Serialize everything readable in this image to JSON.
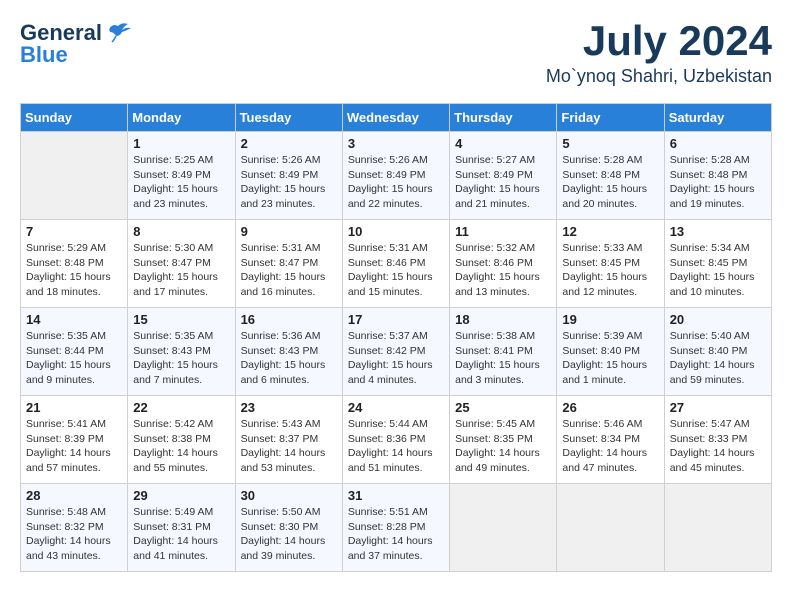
{
  "header": {
    "logo_general": "General",
    "logo_blue": "Blue",
    "month": "July 2024",
    "location": "Mo`ynoq Shahri, Uzbekistan"
  },
  "calendar": {
    "days_of_week": [
      "Sunday",
      "Monday",
      "Tuesday",
      "Wednesday",
      "Thursday",
      "Friday",
      "Saturday"
    ],
    "weeks": [
      [
        {
          "day": "",
          "info": ""
        },
        {
          "day": "1",
          "info": "Sunrise: 5:25 AM\nSunset: 8:49 PM\nDaylight: 15 hours\nand 23 minutes."
        },
        {
          "day": "2",
          "info": "Sunrise: 5:26 AM\nSunset: 8:49 PM\nDaylight: 15 hours\nand 23 minutes."
        },
        {
          "day": "3",
          "info": "Sunrise: 5:26 AM\nSunset: 8:49 PM\nDaylight: 15 hours\nand 22 minutes."
        },
        {
          "day": "4",
          "info": "Sunrise: 5:27 AM\nSunset: 8:49 PM\nDaylight: 15 hours\nand 21 minutes."
        },
        {
          "day": "5",
          "info": "Sunrise: 5:28 AM\nSunset: 8:48 PM\nDaylight: 15 hours\nand 20 minutes."
        },
        {
          "day": "6",
          "info": "Sunrise: 5:28 AM\nSunset: 8:48 PM\nDaylight: 15 hours\nand 19 minutes."
        }
      ],
      [
        {
          "day": "7",
          "info": "Sunrise: 5:29 AM\nSunset: 8:48 PM\nDaylight: 15 hours\nand 18 minutes."
        },
        {
          "day": "8",
          "info": "Sunrise: 5:30 AM\nSunset: 8:47 PM\nDaylight: 15 hours\nand 17 minutes."
        },
        {
          "day": "9",
          "info": "Sunrise: 5:31 AM\nSunset: 8:47 PM\nDaylight: 15 hours\nand 16 minutes."
        },
        {
          "day": "10",
          "info": "Sunrise: 5:31 AM\nSunset: 8:46 PM\nDaylight: 15 hours\nand 15 minutes."
        },
        {
          "day": "11",
          "info": "Sunrise: 5:32 AM\nSunset: 8:46 PM\nDaylight: 15 hours\nand 13 minutes."
        },
        {
          "day": "12",
          "info": "Sunrise: 5:33 AM\nSunset: 8:45 PM\nDaylight: 15 hours\nand 12 minutes."
        },
        {
          "day": "13",
          "info": "Sunrise: 5:34 AM\nSunset: 8:45 PM\nDaylight: 15 hours\nand 10 minutes."
        }
      ],
      [
        {
          "day": "14",
          "info": "Sunrise: 5:35 AM\nSunset: 8:44 PM\nDaylight: 15 hours\nand 9 minutes."
        },
        {
          "day": "15",
          "info": "Sunrise: 5:35 AM\nSunset: 8:43 PM\nDaylight: 15 hours\nand 7 minutes."
        },
        {
          "day": "16",
          "info": "Sunrise: 5:36 AM\nSunset: 8:43 PM\nDaylight: 15 hours\nand 6 minutes."
        },
        {
          "day": "17",
          "info": "Sunrise: 5:37 AM\nSunset: 8:42 PM\nDaylight: 15 hours\nand 4 minutes."
        },
        {
          "day": "18",
          "info": "Sunrise: 5:38 AM\nSunset: 8:41 PM\nDaylight: 15 hours\nand 3 minutes."
        },
        {
          "day": "19",
          "info": "Sunrise: 5:39 AM\nSunset: 8:40 PM\nDaylight: 15 hours\nand 1 minute."
        },
        {
          "day": "20",
          "info": "Sunrise: 5:40 AM\nSunset: 8:40 PM\nDaylight: 14 hours\nand 59 minutes."
        }
      ],
      [
        {
          "day": "21",
          "info": "Sunrise: 5:41 AM\nSunset: 8:39 PM\nDaylight: 14 hours\nand 57 minutes."
        },
        {
          "day": "22",
          "info": "Sunrise: 5:42 AM\nSunset: 8:38 PM\nDaylight: 14 hours\nand 55 minutes."
        },
        {
          "day": "23",
          "info": "Sunrise: 5:43 AM\nSunset: 8:37 PM\nDaylight: 14 hours\nand 53 minutes."
        },
        {
          "day": "24",
          "info": "Sunrise: 5:44 AM\nSunset: 8:36 PM\nDaylight: 14 hours\nand 51 minutes."
        },
        {
          "day": "25",
          "info": "Sunrise: 5:45 AM\nSunset: 8:35 PM\nDaylight: 14 hours\nand 49 minutes."
        },
        {
          "day": "26",
          "info": "Sunrise: 5:46 AM\nSunset: 8:34 PM\nDaylight: 14 hours\nand 47 minutes."
        },
        {
          "day": "27",
          "info": "Sunrise: 5:47 AM\nSunset: 8:33 PM\nDaylight: 14 hours\nand 45 minutes."
        }
      ],
      [
        {
          "day": "28",
          "info": "Sunrise: 5:48 AM\nSunset: 8:32 PM\nDaylight: 14 hours\nand 43 minutes."
        },
        {
          "day": "29",
          "info": "Sunrise: 5:49 AM\nSunset: 8:31 PM\nDaylight: 14 hours\nand 41 minutes."
        },
        {
          "day": "30",
          "info": "Sunrise: 5:50 AM\nSunset: 8:30 PM\nDaylight: 14 hours\nand 39 minutes."
        },
        {
          "day": "31",
          "info": "Sunrise: 5:51 AM\nSunset: 8:28 PM\nDaylight: 14 hours\nand 37 minutes."
        },
        {
          "day": "",
          "info": ""
        },
        {
          "day": "",
          "info": ""
        },
        {
          "day": "",
          "info": ""
        }
      ]
    ]
  }
}
